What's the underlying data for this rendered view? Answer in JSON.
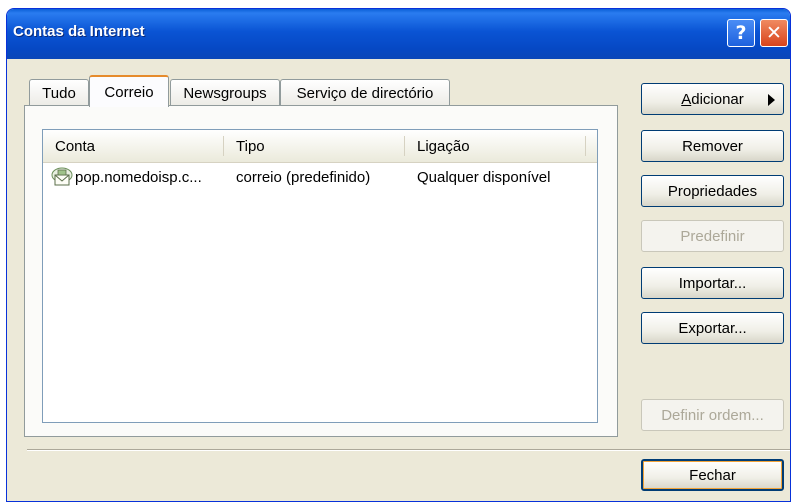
{
  "window": {
    "title": "Contas da Internet"
  },
  "titlebar": {
    "help_glyph": "?",
    "close_glyph": "✕"
  },
  "tabs": [
    {
      "label": "Tudo",
      "active": false
    },
    {
      "label": "Correio",
      "active": true
    },
    {
      "label": "Newsgroups",
      "active": false
    },
    {
      "label": "Serviço de directório",
      "active": false
    }
  ],
  "list": {
    "columns": [
      "Conta",
      "Tipo",
      "Ligação"
    ],
    "rows": [
      {
        "conta": "pop.nomedoisp.c...",
        "tipo": "correio (predefinido)",
        "ligacao": "Qualquer disponível",
        "icon": "mail-account-icon"
      }
    ]
  },
  "buttons": {
    "adicionar_first": "A",
    "adicionar_rest": "dicionar",
    "remover": "Remover",
    "propriedades": "Propriedades",
    "predefinir": "Predefinir",
    "importar": "Importar...",
    "exportar": "Exportar...",
    "definir_ordem": "Definir ordem...",
    "fechar": "Fechar"
  },
  "colors": {
    "titlebar": "#0a54d4",
    "dialog_bg": "#ece9d8",
    "tab_accent": "#e68b2c",
    "button_border": "#003c74"
  }
}
